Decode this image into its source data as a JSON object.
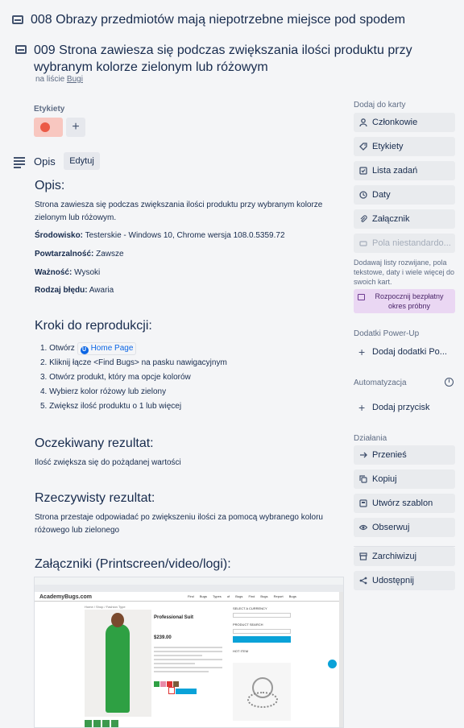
{
  "previous_card": {
    "title": "008 Obrazy przedmiotów mają niepotrzebne miejsce pod spodem"
  },
  "card": {
    "title": "009 Strona zawiesza się podczas zwiększania ilości produktu przy wybranym kolorze zielonym lub różowym",
    "list_prefix": "na liście",
    "list_name": "Bugi"
  },
  "labels": {
    "heading": "Etykiety",
    "add": "+",
    "chip_color": "#eb5a46"
  },
  "description": {
    "label": "Opis",
    "edit_button": "Edytuj",
    "opis_heading": "Opis:",
    "opis_text": "Strona zawiesza się podczas zwiększania ilości produktu przy wybranym kolorze zielonym lub różowym.",
    "env_label": "Środowisko:",
    "env_value": "Testerskie - Windows 10, Chrome wersja 108.0.5359.72",
    "repro_label": "Powtarzalność:",
    "repro_value": "Zawsze",
    "sev_label": "Ważność:",
    "sev_value": "Wysoki",
    "type_label": "Rodzaj błędu:",
    "type_value": "Awaria",
    "steps_heading": "Kroki do reprodukcji:",
    "step1_prefix": "1. Otwórz",
    "step1_link": "Home Page",
    "step2": "2. Kliknij łącze <Find Bugs> na pasku nawigacyjnym",
    "step3": "3. Otwórz produkt, który ma opcje kolorów",
    "step4": "4. Wybierz kolor różowy lub zielony",
    "step5": "5. Zwiększ ilość produktu o 1 lub więcej",
    "expected_heading": "Oczekiwany rezultat:",
    "expected_text": "Ilość zwiększa się do pożądanej wartości",
    "actual_heading": "Rzeczywisty rezultat:",
    "actual_text": "Strona przestaje odpowiadać po zwiększeniu ilości za pomocą wybranego koloru różowego lub zielonego",
    "attachments_heading": "Załączniki (Printscreen/video/logi):"
  },
  "attachment_shot": {
    "brand": "AcademyBugs.com",
    "nav": "Find Bugs  Types of Bugs  Find Bugs  Report Bugs",
    "crumbs": "Home / Shop / Fashion Type",
    "product_title": "Professional Suit",
    "price": "$239.00",
    "side_title": "SELECT A CURRENCY",
    "side_search": "PRODUCT SEARCH",
    "side_hot": "HOT ITEM"
  },
  "sidebar": {
    "add_heading": "Dodaj do karty",
    "members": "Członkowie",
    "labels": "Etykiety",
    "checklist": "Lista zadań",
    "dates": "Daty",
    "attachment": "Załącznik",
    "custom_fields": "Pola niestandardo...",
    "custom_note": "Dodawaj listy rozwijane, pola tekstowe, daty i wiele więcej do swoich kart.",
    "trial_button": "Rozpocznij bezpłatny okres próbny",
    "powerups_heading": "Dodatki Power-Up",
    "add_powerups": "Dodaj dodatki Po...",
    "automation_heading": "Automatyzacja",
    "add_button": "Dodaj przycisk",
    "actions_heading": "Działania",
    "move": "Przenieś",
    "copy": "Kopiuj",
    "template": "Utwórz szablon",
    "watch": "Obserwuj",
    "archive": "Zarchiwizuj",
    "share": "Udostępnij"
  }
}
